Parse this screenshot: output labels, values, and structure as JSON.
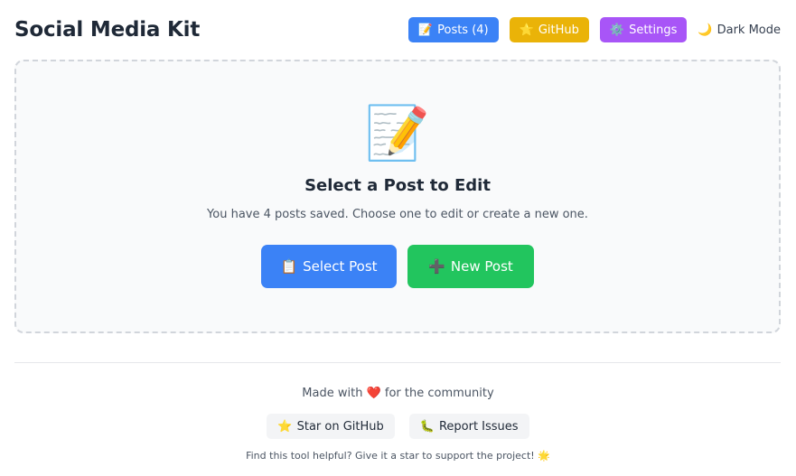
{
  "header": {
    "title": "Social Media Kit",
    "nav": {
      "posts": {
        "icon": "📝",
        "label": "Posts (4)"
      },
      "github": {
        "icon": "⭐",
        "label": "GitHub"
      },
      "settings": {
        "icon": "⚙️",
        "label": "Settings"
      },
      "dark_mode": {
        "icon": "🌙",
        "label": "Dark Mode"
      }
    }
  },
  "empty_state": {
    "icon": "📝",
    "title": "Select a Post to Edit",
    "subtitle": "You have 4 posts saved. Choose one to edit or create a new one.",
    "select_button": {
      "icon": "📋",
      "label": "Select Post"
    },
    "new_button": {
      "icon": "➕",
      "label": "New Post"
    }
  },
  "footer": {
    "made_with_prefix": "Made with",
    "heart": "❤️",
    "made_with_suffix": "for the community",
    "star_button": {
      "icon": "⭐",
      "label": "Star on GitHub"
    },
    "issues_button": {
      "icon": "🐛",
      "label": "Report Issues"
    },
    "note": "Find this tool helpful? Give it a star to support the project! 🌟"
  },
  "colors": {
    "primary": "#3b82f6",
    "github": "#eab308",
    "settings": "#a855f7",
    "success": "#22c55e"
  }
}
